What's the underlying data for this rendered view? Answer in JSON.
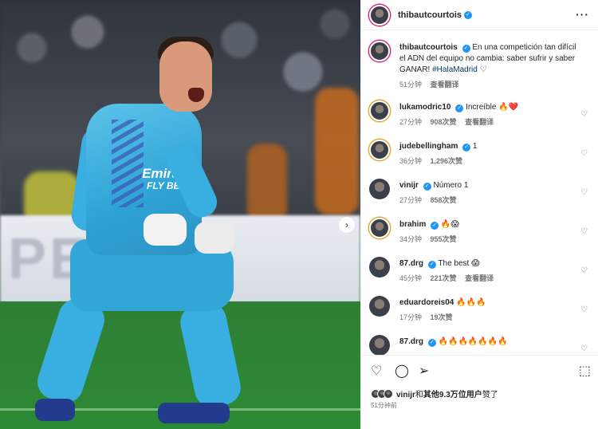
{
  "header": {
    "username": "thibautcourtois",
    "more_icon": "more-dots-icon"
  },
  "photo": {
    "board_text": "PEPSI",
    "sponsor": "Emirates",
    "sponsor_sub": "FLY BETTER",
    "next_icon": "chevron-right-icon"
  },
  "caption": {
    "username": "thibautcourtois",
    "text": "En una competición tan difícil el ADN del equipo no cambia: saber sufrir y saber GANAR!",
    "hashtag": "#HalaMadrid",
    "emoji": "♡",
    "time": "51分钟",
    "translate": "查看翻译"
  },
  "comments": [
    {
      "username": "lukamodric10",
      "text": "Increíble 🔥❤️",
      "time": "27分钟",
      "likes": "908次赞",
      "reply": "查看翻译"
    },
    {
      "username": "judebellingham",
      "text": "1",
      "time": "36分钟",
      "likes": "1,296次赞",
      "reply": ""
    },
    {
      "username": "vinijr",
      "text": "Número 1",
      "time": "27分钟",
      "likes": "858次赞",
      "reply": ""
    },
    {
      "username": "brahim",
      "text": "🔥😱",
      "time": "34分钟",
      "likes": "955次赞",
      "reply": ""
    },
    {
      "username": "87.drg",
      "text": "The best 😱",
      "time": "45分钟",
      "likes": "221次赞",
      "reply": "查看翻译"
    },
    {
      "username": "eduardoreis04",
      "text": "🔥🔥🔥",
      "time": "17分钟",
      "likes": "19次赞",
      "reply": ""
    },
    {
      "username": "87.drg",
      "text": "🔥🔥🔥🔥🔥🔥🔥",
      "time": "",
      "likes": "",
      "reply": ""
    }
  ],
  "actions": {
    "like_icon": "heart-icon",
    "comment_icon": "comment-icon",
    "share_icon": "send-icon",
    "save_icon": "bookmark-icon"
  },
  "likes": {
    "first_user": "vinijr",
    "joiner": "和",
    "others": "其他9.3万位用户",
    "suffix": "赞了"
  },
  "post_time": "51分钟前",
  "colors": {
    "verified": "#1f95f5",
    "story_ring": "#d62976",
    "link": "#00376b",
    "muted": "#737373"
  }
}
